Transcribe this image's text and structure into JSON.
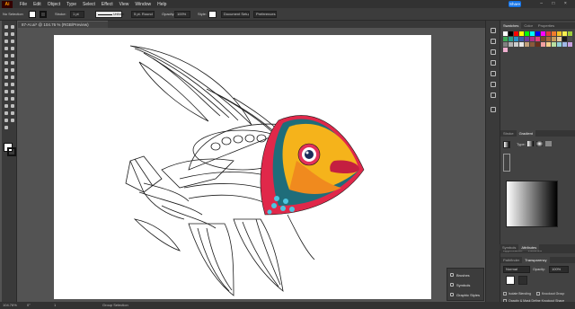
{
  "app": {
    "logo": "Ai",
    "menu": [
      "File",
      "Edit",
      "Object",
      "Type",
      "Select",
      "Effect",
      "View",
      "Window",
      "Help"
    ],
    "share_label": "Share"
  },
  "control_bar": {
    "selection": "No Selection",
    "stroke_label": "Stroke:",
    "stroke_value": "1 pt",
    "uniform": "Uniform",
    "brush": "5 pt. Round",
    "opacity_label": "Opacity:",
    "opacity_value": "100%",
    "style_label": "Style:",
    "doc_setup": "Document Setup",
    "preferences": "Preferences"
  },
  "document": {
    "tab_title": "87-AI.ai* @ 104.76 % (RGB/Preview)"
  },
  "status_bar": {
    "zoom": "104.76%",
    "angle": "0°",
    "artboard": "1",
    "tool": "Group Selection"
  },
  "panels": {
    "swatches_tabs": [
      "Swatches",
      "Color",
      "Properties"
    ],
    "gradient_tabs": [
      "Stroke",
      "Gradient"
    ],
    "gradient_type_label": "Type:",
    "appearance_tabs": [
      "Appearance",
      "Libraries"
    ],
    "transparency_tabs": [
      "Pathfinder",
      "Transparency"
    ],
    "transparency": {
      "blend_mode": "Normal",
      "opacity_label": "Opacity:",
      "opacity_value": "100%",
      "isolate_blending": "Isolate Blending",
      "knockout_group": "Knockout Group",
      "opacity_mask_label": "Opacity & Mask Define Knockout Shape"
    },
    "export_tabs": [
      "Symbols",
      "Attributes"
    ]
  },
  "libraries_panel": {
    "items": [
      "Brushes",
      "Symbols",
      "Graphic Styles"
    ]
  },
  "colors": {
    "accent": "#1473e6",
    "fish_head": "#f5b31b",
    "fish_red": "#e0284a",
    "fish_teal": "#1f6d7a",
    "fish_eye_ring": "#e2305a"
  },
  "swatch_colors": [
    "#ffffff",
    "#000000",
    "#ff0000",
    "#ffff00",
    "#00ff00",
    "#00ffff",
    "#0000ff",
    "#ff00ff",
    "#e23c3c",
    "#f07b2c",
    "#f5c325",
    "#f8ef4f",
    "#9ccb3b",
    "#3caa54",
    "#2aa18b",
    "#2a8fc6",
    "#3c5aa8",
    "#6c3c98",
    "#b02f8b",
    "#e5407a",
    "#7a4a2a",
    "#a66a3a",
    "#c69a5a",
    "#e3c89a",
    "#1a1a1a",
    "#4d4d4d",
    "#808080",
    "#b3b3b3",
    "#cccccc",
    "#e6e6e6",
    "#c2a07a",
    "#8a5a3a",
    "#6a2f1a",
    "#f2a0a0",
    "#f5d08a",
    "#b8e0a0",
    "#8fd0d8",
    "#a0b8e8",
    "#c8a0e0",
    "#f0b0d0"
  ]
}
